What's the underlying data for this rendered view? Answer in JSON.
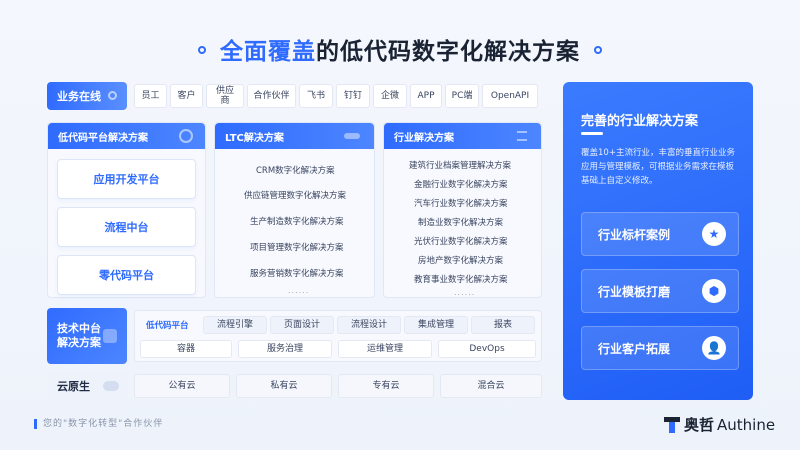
{
  "title": {
    "highlight": "全面覆盖",
    "rest": "的低代码数字化解决方案"
  },
  "row_business": {
    "label": "业务在线",
    "items": [
      "员工",
      "客户",
      "供应商",
      "合作伙伴",
      "飞书",
      "钉钉",
      "企微",
      "APP",
      "PC端",
      "OpenAPI"
    ]
  },
  "card_lowcode": {
    "title": "低代码平台解决方案",
    "items": [
      "应用开发平台",
      "流程中台",
      "零代码平台"
    ]
  },
  "card_ltc": {
    "title": "LTC解决方案",
    "items": [
      "CRM数字化解决方案",
      "供应链管理数字化解决方案",
      "生产制造数字化解决方案",
      "项目管理数字化解决方案",
      "服务营销数字化解决方案"
    ],
    "more": "......"
  },
  "card_industry": {
    "title": "行业解决方案",
    "items": [
      "建筑行业档案管理解决方案",
      "金融行业数字化解决方案",
      "汽车行业数字化解决方案",
      "制造业数字化解决方案",
      "光伏行业数字化解决方案",
      "房地产数字化解决方案",
      "教育事业数字化解决方案"
    ],
    "more": "......"
  },
  "row_tech": {
    "label": "技术中台\n解决方案",
    "top": [
      "低代码平台",
      "流程引擎",
      "页面设计",
      "流程设计",
      "集成管理",
      "报表"
    ],
    "bottom": [
      "容器",
      "服务治理",
      "运维管理",
      "DevOps"
    ]
  },
  "row_cloud": {
    "label": "云原生",
    "items": [
      "公有云",
      "私有云",
      "专有云",
      "混合云"
    ]
  },
  "right_panel": {
    "title": "完善的行业解决方案",
    "desc": "覆盖10+主流行业，丰富的垂直行业业务应用与管理模板，可根据业务需求在模板基础上自定义修改。",
    "buttons": [
      {
        "label": "行业标杆案例",
        "icon": "star-icon"
      },
      {
        "label": "行业模板打磨",
        "icon": "cube-icon"
      },
      {
        "label": "行业客户拓展",
        "icon": "user-icon"
      }
    ]
  },
  "footer": {
    "tagline": "您的\"数字化转型\"合作伙伴"
  },
  "logo": {
    "cn": "奥哲",
    "en": "Authine"
  },
  "colors": {
    "accent": "#2f6bff",
    "dark": "#1a2333"
  }
}
